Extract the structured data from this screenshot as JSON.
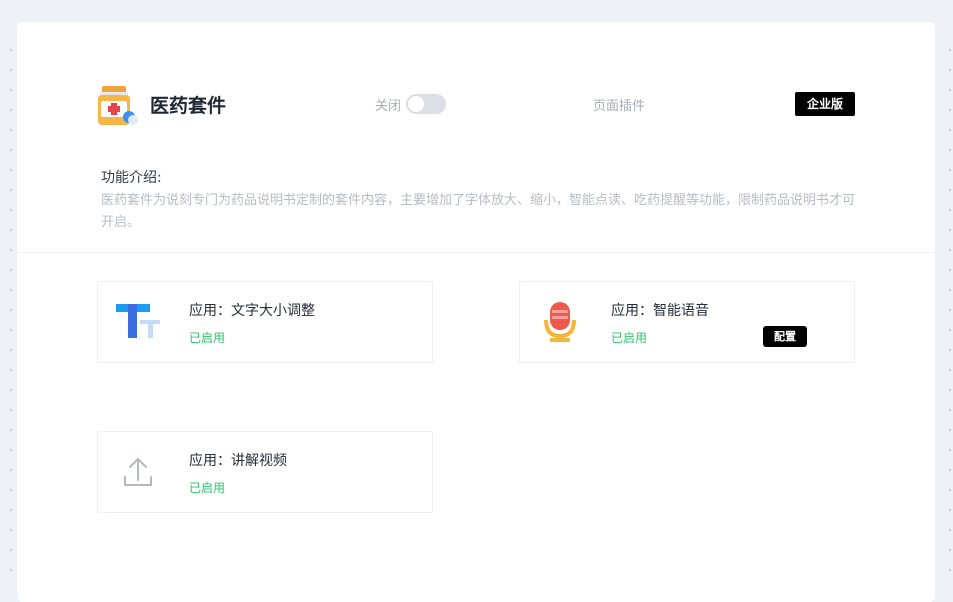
{
  "plugin": {
    "title": "医药套件",
    "switch_label": "关闭",
    "switch_on": false,
    "type": "页面插件",
    "edition": "企业版",
    "intro_title": "功能介绍:",
    "intro_desc": "医药套件为说刻专门为药品说明书定制的套件内容，主要增加了字体放大、缩小，智能点读、吃药提醒等功能，限制药品说明书才可开启。"
  },
  "apps": [
    {
      "title": "应用：文字大小调整",
      "status": "已启用",
      "icon": "font-size-icon"
    },
    {
      "title": "应用：智能语音",
      "status": "已启用",
      "icon": "microphone-icon",
      "button": "配置"
    },
    {
      "title": "应用：讲解视频",
      "status": "已启用",
      "icon": "upload-icon"
    }
  ],
  "colors": {
    "enabled": "#2ec46e",
    "edition_bg": "#000000",
    "page_bg": "#eef1f5"
  }
}
